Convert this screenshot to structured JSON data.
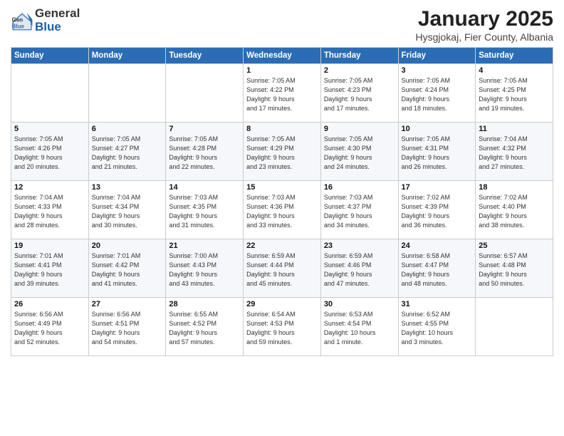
{
  "header": {
    "logo_general": "General",
    "logo_blue": "Blue",
    "month_title": "January 2025",
    "location": "Hysgjokaj, Fier County, Albania"
  },
  "days_of_week": [
    "Sunday",
    "Monday",
    "Tuesday",
    "Wednesday",
    "Thursday",
    "Friday",
    "Saturday"
  ],
  "weeks": [
    [
      {
        "day": "",
        "info": ""
      },
      {
        "day": "",
        "info": ""
      },
      {
        "day": "",
        "info": ""
      },
      {
        "day": "1",
        "info": "Sunrise: 7:05 AM\nSunset: 4:22 PM\nDaylight: 9 hours\nand 17 minutes."
      },
      {
        "day": "2",
        "info": "Sunrise: 7:05 AM\nSunset: 4:23 PM\nDaylight: 9 hours\nand 17 minutes."
      },
      {
        "day": "3",
        "info": "Sunrise: 7:05 AM\nSunset: 4:24 PM\nDaylight: 9 hours\nand 18 minutes."
      },
      {
        "day": "4",
        "info": "Sunrise: 7:05 AM\nSunset: 4:25 PM\nDaylight: 9 hours\nand 19 minutes."
      }
    ],
    [
      {
        "day": "5",
        "info": "Sunrise: 7:05 AM\nSunset: 4:26 PM\nDaylight: 9 hours\nand 20 minutes."
      },
      {
        "day": "6",
        "info": "Sunrise: 7:05 AM\nSunset: 4:27 PM\nDaylight: 9 hours\nand 21 minutes."
      },
      {
        "day": "7",
        "info": "Sunrise: 7:05 AM\nSunset: 4:28 PM\nDaylight: 9 hours\nand 22 minutes."
      },
      {
        "day": "8",
        "info": "Sunrise: 7:05 AM\nSunset: 4:29 PM\nDaylight: 9 hours\nand 23 minutes."
      },
      {
        "day": "9",
        "info": "Sunrise: 7:05 AM\nSunset: 4:30 PM\nDaylight: 9 hours\nand 24 minutes."
      },
      {
        "day": "10",
        "info": "Sunrise: 7:05 AM\nSunset: 4:31 PM\nDaylight: 9 hours\nand 26 minutes."
      },
      {
        "day": "11",
        "info": "Sunrise: 7:04 AM\nSunset: 4:32 PM\nDaylight: 9 hours\nand 27 minutes."
      }
    ],
    [
      {
        "day": "12",
        "info": "Sunrise: 7:04 AM\nSunset: 4:33 PM\nDaylight: 9 hours\nand 28 minutes."
      },
      {
        "day": "13",
        "info": "Sunrise: 7:04 AM\nSunset: 4:34 PM\nDaylight: 9 hours\nand 30 minutes."
      },
      {
        "day": "14",
        "info": "Sunrise: 7:03 AM\nSunset: 4:35 PM\nDaylight: 9 hours\nand 31 minutes."
      },
      {
        "day": "15",
        "info": "Sunrise: 7:03 AM\nSunset: 4:36 PM\nDaylight: 9 hours\nand 33 minutes."
      },
      {
        "day": "16",
        "info": "Sunrise: 7:03 AM\nSunset: 4:37 PM\nDaylight: 9 hours\nand 34 minutes."
      },
      {
        "day": "17",
        "info": "Sunrise: 7:02 AM\nSunset: 4:39 PM\nDaylight: 9 hours\nand 36 minutes."
      },
      {
        "day": "18",
        "info": "Sunrise: 7:02 AM\nSunset: 4:40 PM\nDaylight: 9 hours\nand 38 minutes."
      }
    ],
    [
      {
        "day": "19",
        "info": "Sunrise: 7:01 AM\nSunset: 4:41 PM\nDaylight: 9 hours\nand 39 minutes."
      },
      {
        "day": "20",
        "info": "Sunrise: 7:01 AM\nSunset: 4:42 PM\nDaylight: 9 hours\nand 41 minutes."
      },
      {
        "day": "21",
        "info": "Sunrise: 7:00 AM\nSunset: 4:43 PM\nDaylight: 9 hours\nand 43 minutes."
      },
      {
        "day": "22",
        "info": "Sunrise: 6:59 AM\nSunset: 4:44 PM\nDaylight: 9 hours\nand 45 minutes."
      },
      {
        "day": "23",
        "info": "Sunrise: 6:59 AM\nSunset: 4:46 PM\nDaylight: 9 hours\nand 47 minutes."
      },
      {
        "day": "24",
        "info": "Sunrise: 6:58 AM\nSunset: 4:47 PM\nDaylight: 9 hours\nand 48 minutes."
      },
      {
        "day": "25",
        "info": "Sunrise: 6:57 AM\nSunset: 4:48 PM\nDaylight: 9 hours\nand 50 minutes."
      }
    ],
    [
      {
        "day": "26",
        "info": "Sunrise: 6:56 AM\nSunset: 4:49 PM\nDaylight: 9 hours\nand 52 minutes."
      },
      {
        "day": "27",
        "info": "Sunrise: 6:56 AM\nSunset: 4:51 PM\nDaylight: 9 hours\nand 54 minutes."
      },
      {
        "day": "28",
        "info": "Sunrise: 6:55 AM\nSunset: 4:52 PM\nDaylight: 9 hours\nand 57 minutes."
      },
      {
        "day": "29",
        "info": "Sunrise: 6:54 AM\nSunset: 4:53 PM\nDaylight: 9 hours\nand 59 minutes."
      },
      {
        "day": "30",
        "info": "Sunrise: 6:53 AM\nSunset: 4:54 PM\nDaylight: 10 hours\nand 1 minute."
      },
      {
        "day": "31",
        "info": "Sunrise: 6:52 AM\nSunset: 4:55 PM\nDaylight: 10 hours\nand 3 minutes."
      },
      {
        "day": "",
        "info": ""
      }
    ]
  ]
}
